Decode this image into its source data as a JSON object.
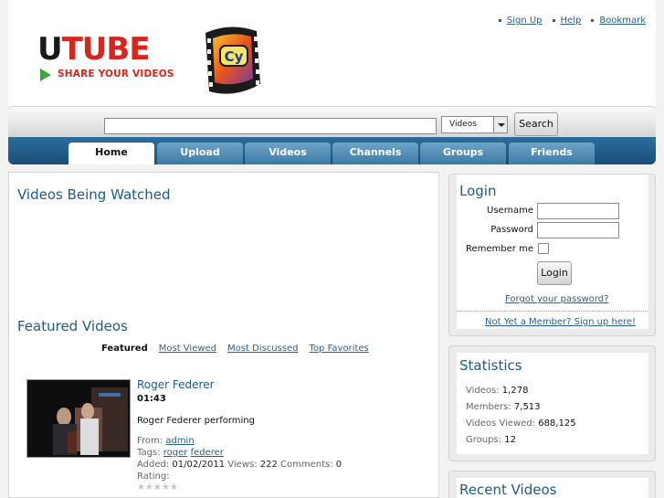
{
  "header": {
    "top_links": [
      "Sign Up",
      "Help",
      "Bookmark"
    ],
    "logo_text_u": "U",
    "logo_text_rest": "TUBE",
    "logo_tagline": "SHARE YOUR VIDEOS",
    "logo_badge": "Cy"
  },
  "search": {
    "input_value": "",
    "select_value": "Videos",
    "button_label": "Search"
  },
  "nav": {
    "tabs": [
      "Home",
      "Upload",
      "Videos",
      "Channels",
      "Groups",
      "Friends"
    ],
    "active": "Home"
  },
  "main": {
    "watched_title": "Videos Being Watched",
    "featured_title": "Featured Videos",
    "subtabs": [
      "Featured",
      "Most Viewed",
      "Most Discussed",
      "Top Favorites"
    ],
    "video": {
      "title": "Roger Federer",
      "duration": "01:43",
      "description": "Roger Federer performing",
      "from_label": "From:",
      "from_user": "admin",
      "tags_label": "Tags:",
      "tags": [
        "roger",
        "federer"
      ],
      "added_label": "Added:",
      "added": "01/02/2011",
      "views_label": "Views:",
      "views": "222",
      "comments_label": "Comments:",
      "comments": "0",
      "rating_label": "Rating:",
      "stars": "★★★★★",
      "rating": 0
    }
  },
  "login": {
    "title": "Login",
    "username_label": "Username",
    "password_label": "Password",
    "remember_label": "Remember me",
    "button_label": "Login",
    "forgot_link": "Forgot your password?",
    "signup_link": "Not Yet a Member? Sign up here!"
  },
  "statistics": {
    "title": "Statistics",
    "items": [
      {
        "label": "Videos:",
        "value": "1,278"
      },
      {
        "label": "Members:",
        "value": "7,513"
      },
      {
        "label": "Videos Viewed:",
        "value": "688,125"
      },
      {
        "label": "Groups:",
        "value": "12"
      }
    ]
  },
  "recent": {
    "title": "Recent Videos"
  },
  "colors": {
    "accent": "#1e5a88",
    "brand_red": "#d7261e",
    "nav_blue": "#1b4f78"
  }
}
